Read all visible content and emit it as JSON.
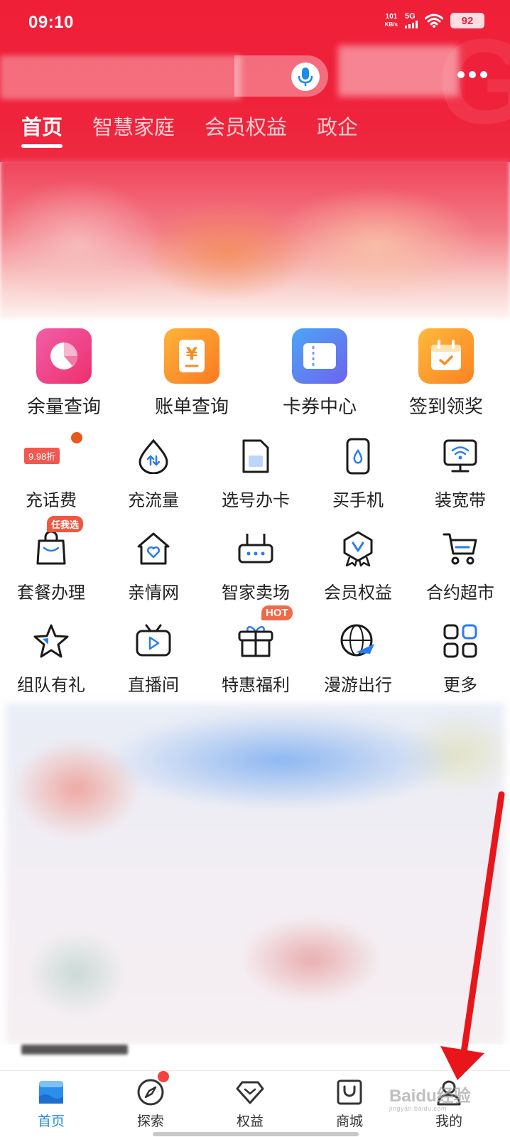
{
  "status_bar": {
    "time": "09:10",
    "net_speed_value": "101",
    "net_speed_unit": "KB/s",
    "network_type": "5G",
    "battery": "92"
  },
  "header": {
    "tabs": [
      {
        "label": "首页",
        "active": true
      },
      {
        "label": "智慧家庭",
        "active": false
      },
      {
        "label": "会员权益",
        "active": false
      },
      {
        "label": "政企",
        "active": false
      }
    ]
  },
  "quick_actions": [
    {
      "label": "余量查询",
      "icon": "pie-chart-icon",
      "color": "#f0428c"
    },
    {
      "label": "账单查询",
      "icon": "bill-icon",
      "color": "#fb8c22"
    },
    {
      "label": "卡券中心",
      "icon": "coupon-icon",
      "color": "#5a84f4"
    },
    {
      "label": "签到领奖",
      "icon": "calendar-check-icon",
      "color": "#fb9a26"
    }
  ],
  "services": [
    {
      "label": "充话费",
      "icon": "recharge-icon",
      "badge": "9.98折"
    },
    {
      "label": "充流量",
      "icon": "data-drop-icon"
    },
    {
      "label": "选号办卡",
      "icon": "sim-card-icon"
    },
    {
      "label": "买手机",
      "icon": "phone-icon"
    },
    {
      "label": "装宽带",
      "icon": "broadband-icon"
    },
    {
      "label": "套餐办理",
      "icon": "shopping-bag-icon",
      "badge": "任我选"
    },
    {
      "label": "亲情网",
      "icon": "heart-home-icon"
    },
    {
      "label": "智家卖场",
      "icon": "router-icon"
    },
    {
      "label": "会员权益",
      "icon": "member-badge-icon"
    },
    {
      "label": "合约超市",
      "icon": "cart-icon"
    },
    {
      "label": "组队有礼",
      "icon": "star-icon"
    },
    {
      "label": "直播间",
      "icon": "tv-icon"
    },
    {
      "label": "特惠福利",
      "icon": "gift-icon",
      "badge": "HOT"
    },
    {
      "label": "漫游出行",
      "icon": "globe-plane-icon"
    },
    {
      "label": "更多",
      "icon": "grid-more-icon"
    }
  ],
  "bottom_nav": [
    {
      "label": "首页",
      "icon": "home-icon",
      "active": true
    },
    {
      "label": "探索",
      "icon": "compass-icon",
      "dot": true
    },
    {
      "label": "权益",
      "icon": "diamond-icon"
    },
    {
      "label": "商城",
      "icon": "mall-bag-icon"
    },
    {
      "label": "我的",
      "icon": "user-icon"
    }
  ],
  "watermark": {
    "text": "Baidu经验",
    "sub": "jingyan.baidu.com"
  },
  "colors": {
    "brand_red": "#ef1f38",
    "active_blue": "#1d8be8",
    "arrow_red": "#e8161b"
  }
}
